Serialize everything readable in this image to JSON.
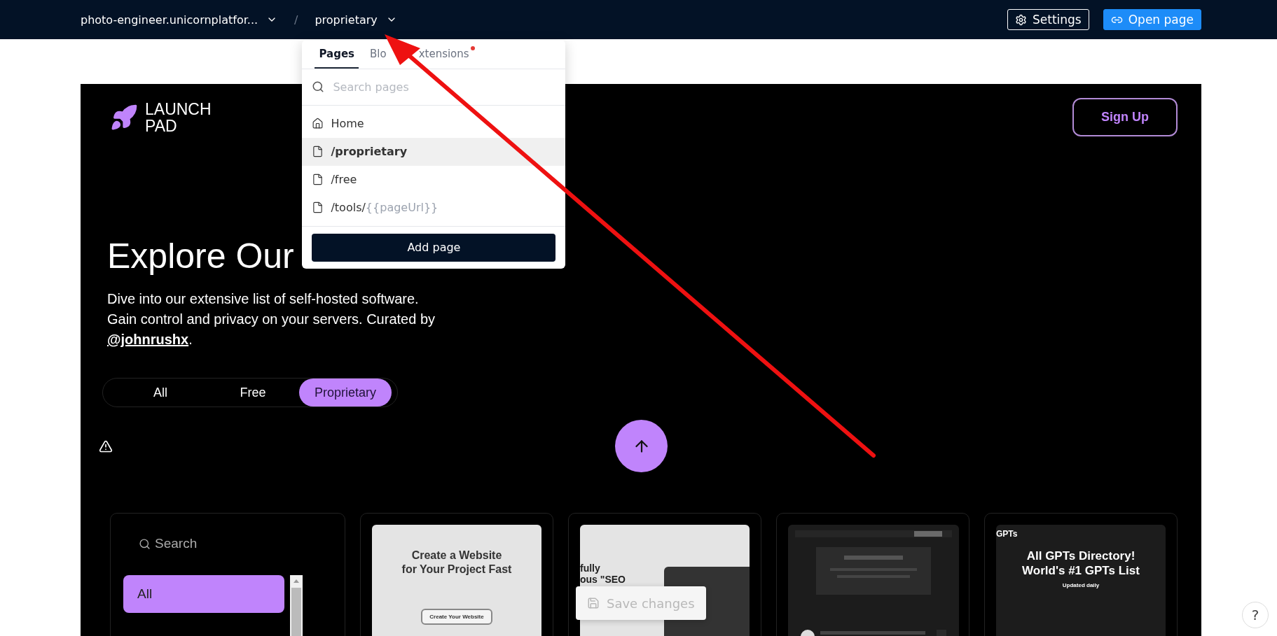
{
  "topbar": {
    "site": "photo-engineer.unicornplatfor...",
    "separator": "/",
    "page": "proprietary",
    "buttons": [
      {
        "kind": "settings",
        "label": "Settings"
      },
      {
        "kind": "open",
        "label": "Open page"
      }
    ]
  },
  "dropdown": {
    "tabs": [
      {
        "label": "Pages",
        "selected": true,
        "badge": false
      },
      {
        "label": "Blo",
        "selected": false,
        "badge": false
      },
      {
        "label": "xtensions",
        "selected": false,
        "badge": true
      }
    ],
    "search": {
      "placeholder": "Search pages"
    },
    "items": [
      {
        "kind": "home",
        "path": "Home",
        "selected": false
      },
      {
        "kind": "page",
        "path": "/proprietary",
        "selected": true
      },
      {
        "kind": "page",
        "path": "/free",
        "selected": false
      },
      {
        "kind": "page",
        "path": "/tools/",
        "param": "{{pageUrl}}",
        "selected": false
      }
    ],
    "add_button": "Add page"
  },
  "site": {
    "logo": [
      "LAUNCH",
      "PAD"
    ],
    "signup": "Sign Up",
    "title": "Explore Our",
    "description": "Dive into our extensive list of self-hosted software. Gain control and privacy on your servers. Curated by ",
    "author_link": "@johnrushx",
    "suffix": ".",
    "filters": [
      {
        "label": "All",
        "selected": false
      },
      {
        "label": "Free",
        "selected": false
      },
      {
        "label": "Proprietary",
        "selected": true
      }
    ],
    "cards": [
      {
        "kind": "sidebar",
        "search": {
          "placeholder": "Search"
        },
        "items": [
          {
            "label": "All",
            "selected": true
          }
        ]
      },
      {
        "kind": "light",
        "headings": [
          "Create a Website",
          "for Your Project Fast"
        ],
        "button": "Create Your Website"
      },
      {
        "kind": "device",
        "headings": [
          "fully",
          "ous \"SEO"
        ]
      },
      {
        "kind": "picture"
      },
      {
        "kind": "dark",
        "nav": "GPTs",
        "headings": [
          "All GPTs Directory!",
          "World's #1 GPTs List"
        ],
        "subtitle": "Updated daily"
      }
    ]
  },
  "save_changes": {
    "label": "Save changes",
    "disabled": true
  },
  "help": "?"
}
